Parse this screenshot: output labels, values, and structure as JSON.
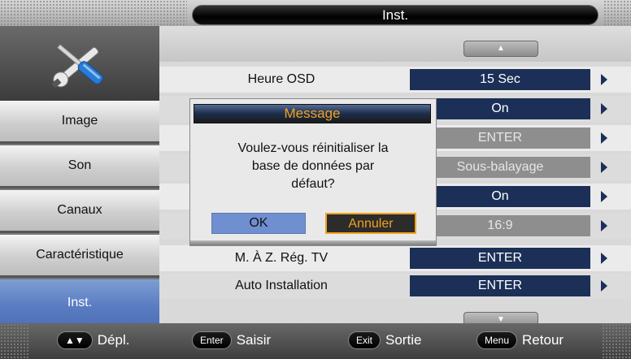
{
  "header": {
    "title": "Inst."
  },
  "sidebar": {
    "tools_icon": "tools-icon",
    "items": [
      {
        "label": "Image"
      },
      {
        "label": "Son"
      },
      {
        "label": "Canaux"
      },
      {
        "label": "Caractéristique"
      },
      {
        "label": "Inst."
      }
    ],
    "active_index": 4
  },
  "settings": {
    "rows": [
      {
        "label": "Heure OSD",
        "value": "15 Sec"
      },
      {
        "label": "",
        "value": "On"
      },
      {
        "label": "",
        "value": "ENTER"
      },
      {
        "label": "",
        "value": "Sous-balayage"
      },
      {
        "label": "",
        "value": "On"
      },
      {
        "label": "",
        "value": "16:9"
      },
      {
        "label": "M. À Z. Rég. TV",
        "value": "ENTER"
      },
      {
        "label": "Auto Installation",
        "value": "ENTER"
      }
    ]
  },
  "dialog": {
    "title": "Message",
    "message_line1": "Voulez-vous réinitialiser la",
    "message_line2": "base de données par",
    "message_line3": "défaut?",
    "ok_label": "OK",
    "cancel_label": "Annuler"
  },
  "footer": {
    "hints": [
      {
        "key": "▲▼",
        "label": "Dépl."
      },
      {
        "key": "Enter",
        "label": "Saisir"
      },
      {
        "key": "Exit",
        "label": "Sortie"
      },
      {
        "key": "Menu",
        "label": "Retour"
      }
    ]
  },
  "colors": {
    "accent_orange": "#f3a21c",
    "value_blue": "#1b2f57",
    "active_blue": "#5a7cc2"
  }
}
